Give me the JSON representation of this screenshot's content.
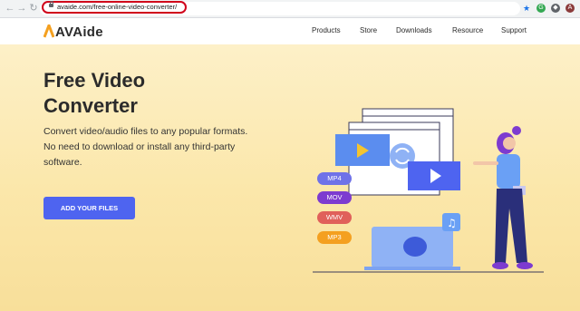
{
  "browser": {
    "url": "avaide.com/free-online-video-converter/",
    "profile_initial": "A"
  },
  "header": {
    "logo": "AVAide",
    "nav": [
      "Products",
      "Store",
      "Downloads",
      "Resource",
      "Support"
    ]
  },
  "hero": {
    "title": "Free Video Converter",
    "description": "Convert video/audio files to any popular formats. No need to download or install any third-party software.",
    "cta_label": "ADD YOUR FILES"
  },
  "illustration": {
    "formats": [
      "MP4",
      "MOV",
      "WMV",
      "MP3"
    ],
    "format_colors": [
      "#6f72e8",
      "#7d3bd0",
      "#e0605a",
      "#f4a020"
    ]
  },
  "colors": {
    "accent": "#4e64f0",
    "url_highlight": "#d0021b"
  }
}
